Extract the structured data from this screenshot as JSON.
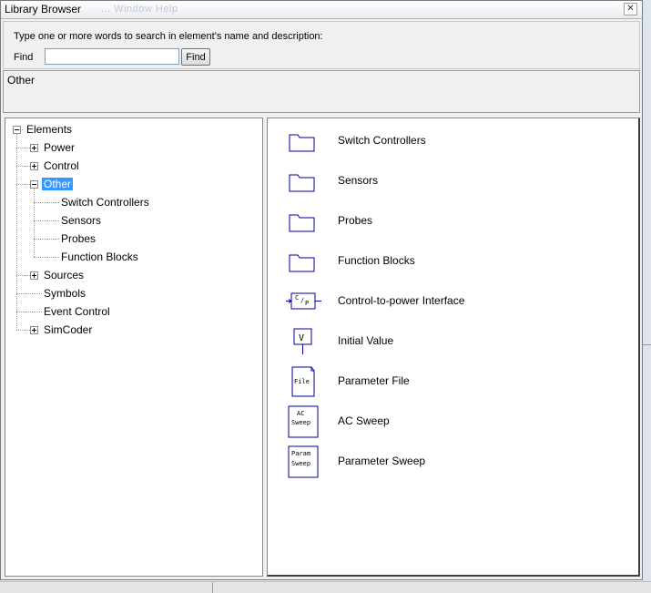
{
  "window": {
    "title": "Library Browser",
    "ghost_title": "... Window Help",
    "close_glyph": "✕"
  },
  "search": {
    "hint": "Type one or more words to search in element's name and  description:",
    "find_label": "Find",
    "find_value": "",
    "find_button": "Find"
  },
  "description": {
    "text": "Other"
  },
  "tree": {
    "root": "Elements",
    "items": [
      {
        "label": "Power",
        "expanded": false
      },
      {
        "label": "Control",
        "expanded": false
      },
      {
        "label": "Other",
        "expanded": true,
        "selected": true,
        "children": [
          "Switch Controllers",
          "Sensors",
          "Probes",
          "Function Blocks"
        ]
      },
      {
        "label": "Sources",
        "expanded": false
      },
      {
        "label": "Symbols"
      },
      {
        "label": "Event Control"
      },
      {
        "label": "SimCoder",
        "expanded": false
      }
    ]
  },
  "items": [
    {
      "label": "Switch Controllers",
      "icon": "folder-icon"
    },
    {
      "label": "Sensors",
      "icon": "folder-icon"
    },
    {
      "label": "Probes",
      "icon": "folder-icon"
    },
    {
      "label": "Function Blocks",
      "icon": "folder-icon"
    },
    {
      "label": "Control-to-power Interface",
      "icon": "control-to-power-icon",
      "icon_text": [
        "C",
        "/",
        "P"
      ]
    },
    {
      "label": "Initial Value",
      "icon": "initial-value-icon",
      "icon_text": "V"
    },
    {
      "label": "Parameter File",
      "icon": "parameter-file-icon",
      "icon_text": "File"
    },
    {
      "label": "AC Sweep",
      "icon": "ac-sweep-icon",
      "icon_text": [
        "AC",
        "Sweep"
      ]
    },
    {
      "label": "Parameter Sweep",
      "icon": "parameter-sweep-icon",
      "icon_text": [
        "Param",
        "Sweep"
      ]
    }
  ],
  "colors": {
    "selection": "#3399ff",
    "icon_stroke": "#0000a0"
  }
}
